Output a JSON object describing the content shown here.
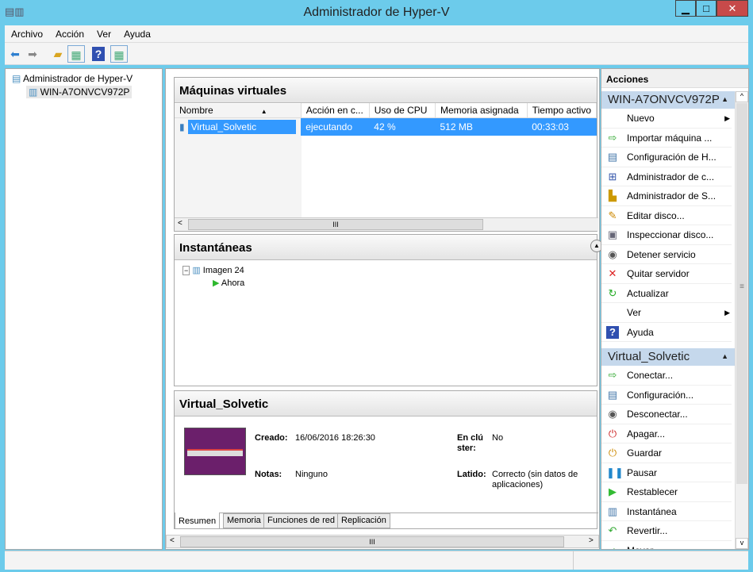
{
  "window": {
    "title": "Administrador de Hyper-V",
    "minimize": "▁",
    "maximize": "□",
    "close": "✕"
  },
  "menu": [
    "Archivo",
    "Acción",
    "Ver",
    "Ayuda"
  ],
  "toolbar": {
    "icons": [
      "back-arrow-icon",
      "forward-arrow-icon",
      "up-folder-icon",
      "show-hide-tree-icon",
      "help-icon",
      "show-hide-action-pane-icon"
    ]
  },
  "tree": {
    "root": "Administrador de Hyper-V",
    "child": "WIN-A7ONVCV972P"
  },
  "vms": {
    "title": "Máquinas virtuales",
    "columns": [
      "Nombre",
      "Acción en c...",
      "Uso de CPU",
      "Memoria asignada",
      "Tiempo activo"
    ],
    "rows": [
      {
        "name": "Virtual_Solvetic",
        "state": "ejecutando",
        "cpu": "42 %",
        "memory": "512 MB",
        "uptime": "00:33:03"
      }
    ],
    "scroll_thumb": "III"
  },
  "snapshots": {
    "title": "Instantáneas",
    "items": [
      "Imagen 24",
      "Ahora"
    ]
  },
  "details": {
    "title": "Virtual_Solvetic",
    "created_label": "Creado:",
    "created": "16/06/2016 18:26:30",
    "notes_label": "Notas:",
    "notes": "Ninguno",
    "cluster_label": "En clúster:",
    "cluster": "No",
    "heartbeat_label": "Latido:",
    "heartbeat": "Correcto (sin datos de aplicaciones)",
    "tabs": [
      "Resumen",
      "Memoria",
      "Funciones de red",
      "Replicación"
    ],
    "active_tab": "Resumen",
    "scroll_thumb": "III"
  },
  "actions": {
    "title": "Acciones",
    "server": {
      "title": "WIN-A7ONVCV972P",
      "items": [
        {
          "label": "Nuevo",
          "icon": "none",
          "submenu": true
        },
        {
          "label": "Importar máquina ...",
          "icon": "import-icon"
        },
        {
          "label": "Configuración de H...",
          "icon": "settings-icon"
        },
        {
          "label": "Administrador de c...",
          "icon": "switch-manager-icon"
        },
        {
          "label": "Administrador de S...",
          "icon": "san-manager-icon"
        },
        {
          "label": "Editar disco...",
          "icon": "edit-disk-icon"
        },
        {
          "label": "Inspeccionar disco...",
          "icon": "inspect-disk-icon"
        },
        {
          "label": "Detener servicio",
          "icon": "stop-icon"
        },
        {
          "label": "Quitar servidor",
          "icon": "remove-icon"
        },
        {
          "label": "Actualizar",
          "icon": "refresh-icon"
        },
        {
          "label": "Ver",
          "icon": "none",
          "submenu": true
        },
        {
          "label": "Ayuda",
          "icon": "help-icon"
        }
      ]
    },
    "vm": {
      "title": "Virtual_Solvetic",
      "items": [
        {
          "label": "Conectar...",
          "icon": "connect-icon"
        },
        {
          "label": "Configuración...",
          "icon": "settings-icon"
        },
        {
          "label": "Desconectar...",
          "icon": "turn-off-icon"
        },
        {
          "label": "Apagar...",
          "icon": "shutdown-icon"
        },
        {
          "label": "Guardar",
          "icon": "save-icon"
        },
        {
          "label": "Pausar",
          "icon": "pause-icon"
        },
        {
          "label": "Restablecer",
          "icon": "reset-icon"
        },
        {
          "label": "Instantánea",
          "icon": "snapshot-icon"
        },
        {
          "label": "Revertir...",
          "icon": "revert-icon"
        },
        {
          "label": "Mover...",
          "icon": "move-icon"
        }
      ]
    }
  }
}
